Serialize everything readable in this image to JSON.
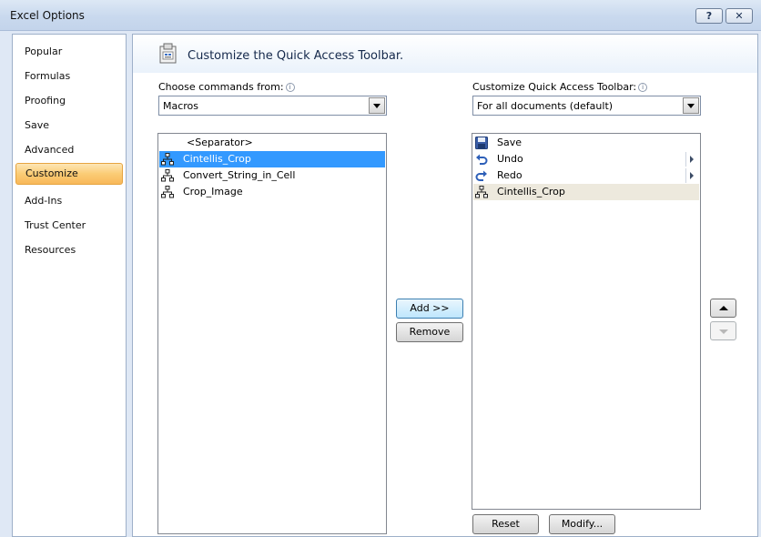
{
  "window": {
    "title": "Excel Options",
    "help_label": "?",
    "close_label": "✕"
  },
  "nav": {
    "items": [
      {
        "label": "Popular"
      },
      {
        "label": "Formulas"
      },
      {
        "label": "Proofing"
      },
      {
        "label": "Save"
      },
      {
        "label": "Advanced"
      },
      {
        "label": "Customize",
        "selected": true
      },
      {
        "label": "Add-Ins"
      },
      {
        "label": "Trust Center"
      },
      {
        "label": "Resources"
      }
    ]
  },
  "header": {
    "title": "Customize the Quick Access Toolbar.",
    "icon": "qat-customize-icon"
  },
  "left": {
    "label": "Choose commands from:",
    "combo_value": "Macros",
    "items": [
      {
        "label": "<Separator>",
        "icon": ""
      },
      {
        "label": "Cintellis_Crop",
        "icon": "macro-icon",
        "selected": true
      },
      {
        "label": "Convert_String_in_Cell",
        "icon": "macro-icon"
      },
      {
        "label": "Crop_Image",
        "icon": "macro-icon"
      }
    ]
  },
  "right": {
    "label": "Customize Quick Access Toolbar:",
    "combo_value": "For all documents (default)",
    "items": [
      {
        "label": "Save",
        "icon": "save-icon"
      },
      {
        "label": "Undo",
        "icon": "undo-icon",
        "submenu": true
      },
      {
        "label": "Redo",
        "icon": "redo-icon",
        "submenu": true
      },
      {
        "label": "Cintellis_Crop",
        "icon": "macro-icon",
        "highlighted": true
      }
    ]
  },
  "buttons": {
    "add": "Add >>",
    "remove": "Remove",
    "reset": "Reset",
    "modify": "Modify..."
  },
  "colors": {
    "selection": "#3399ff",
    "nav_selected": "#fbcc75",
    "highlight_row": "#ede9dd"
  }
}
